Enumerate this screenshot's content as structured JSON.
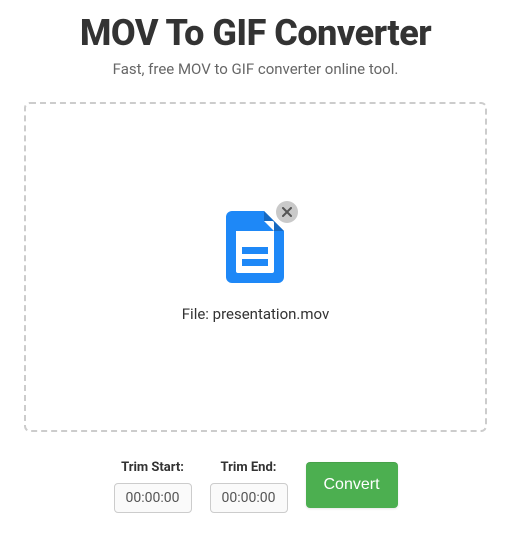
{
  "header": {
    "title": "MOV To GIF Converter",
    "subtitle": "Fast, free MOV to GIF converter online tool."
  },
  "dropzone": {
    "file_label_prefix": "File: ",
    "file_name": "presentation.mov",
    "file_display": "File: presentation.mov"
  },
  "controls": {
    "trim_start_label": "Trim Start:",
    "trim_start_value": "00:00:00",
    "trim_end_label": "Trim End:",
    "trim_end_value": "00:00:00",
    "convert_label": "Convert"
  },
  "colors": {
    "accent": "#1E88F7",
    "convert": "#4CAF50"
  }
}
